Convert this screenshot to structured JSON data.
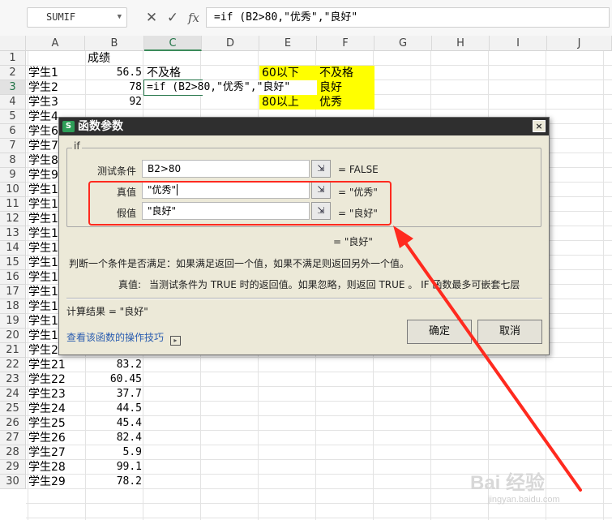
{
  "formula_bar": {
    "name_box": "SUMIF",
    "cancel_icon": "✕",
    "confirm_icon": "✓",
    "fx_label": "fx",
    "formula": "=if (B2>80,\"优秀\",\"良好\""
  },
  "columns": [
    "A",
    "B",
    "C",
    "D",
    "E",
    "F",
    "G",
    "H",
    "I",
    "J"
  ],
  "rows": [
    "1",
    "2",
    "3",
    "4",
    "5",
    "6",
    "7",
    "8",
    "9",
    "10",
    "11",
    "12",
    "13",
    "14",
    "15",
    "16",
    "17",
    "18",
    "19",
    "20",
    "21",
    "22",
    "23",
    "24",
    "25",
    "26",
    "27",
    "28",
    "29",
    "30"
  ],
  "sheet": {
    "b1": "成绩",
    "c2": "不及格",
    "c3_editing": "=if (B2>80,\"优秀\",\"良好\"",
    "lookup": [
      {
        "e": "60以下",
        "f": "不及格"
      },
      {
        "e": "",
        "f": "良好"
      },
      {
        "e": "80以上",
        "f": "优秀"
      }
    ],
    "students": [
      {
        "name": "学生1",
        "score": "56.5"
      },
      {
        "name": "学生2",
        "score": "78"
      },
      {
        "name": "学生3",
        "score": "92"
      },
      {
        "name": "学生4",
        "score": ""
      },
      {
        "name": "学生6",
        "score": ""
      },
      {
        "name": "学生7",
        "score": ""
      },
      {
        "name": "学生8",
        "score": ""
      },
      {
        "name": "学生9",
        "score": ""
      },
      {
        "name": "学生1",
        "score": ""
      },
      {
        "name": "学生1",
        "score": ""
      },
      {
        "name": "学生1",
        "score": ""
      },
      {
        "name": "学生1",
        "score": ""
      },
      {
        "name": "学生1",
        "score": ""
      },
      {
        "name": "学生1",
        "score": ""
      },
      {
        "name": "学生1",
        "score": ""
      },
      {
        "name": "学生1",
        "score": ""
      },
      {
        "name": "学生1",
        "score": ""
      },
      {
        "name": "学生1",
        "score": ""
      },
      {
        "name": "学生1",
        "score": ""
      },
      {
        "name": "学生2",
        "score": ""
      },
      {
        "name": "学生21",
        "score": "83.2"
      },
      {
        "name": "学生22",
        "score": "60.45"
      },
      {
        "name": "学生23",
        "score": "37.7"
      },
      {
        "name": "学生24",
        "score": "44.5"
      },
      {
        "name": "学生25",
        "score": "45.4"
      },
      {
        "name": "学生26",
        "score": "82.4"
      },
      {
        "name": "学生27",
        "score": "5.9"
      },
      {
        "name": "学生28",
        "score": "99.1"
      },
      {
        "name": "学生29",
        "score": "78.2"
      }
    ]
  },
  "dialog": {
    "title": "函数参数",
    "close_icon": "×",
    "function_name": "if",
    "params": [
      {
        "label": "测试条件",
        "value": "B2>80",
        "result": "= FALSE"
      },
      {
        "label": "真值",
        "value": "\"优秀\"",
        "result": "= \"优秀\""
      },
      {
        "label": "假值",
        "value": "\"良好\"",
        "result": "= \"良好\""
      }
    ],
    "overall_result": "= \"良好\"",
    "description": "判断一个条件是否满足：如果满足返回一个值，如果不满足则返回另外一个值。",
    "param_help_label": "真值:",
    "param_help": "当测试条件为 TRUE 时的返回值。如果忽略，则返回 TRUE 。 IF 函数最多可嵌套七层",
    "calc_result": "计算结果 = \"良好\"",
    "help_link": "查看该函数的操作技巧",
    "ok": "确定",
    "cancel": "取消"
  },
  "watermark": {
    "main": "Bai 经验",
    "sub": "jingyan.baidu.com"
  },
  "colors": {
    "highlight": "#ffff00",
    "annotation": "#ff2a1f",
    "select": "#217346"
  }
}
